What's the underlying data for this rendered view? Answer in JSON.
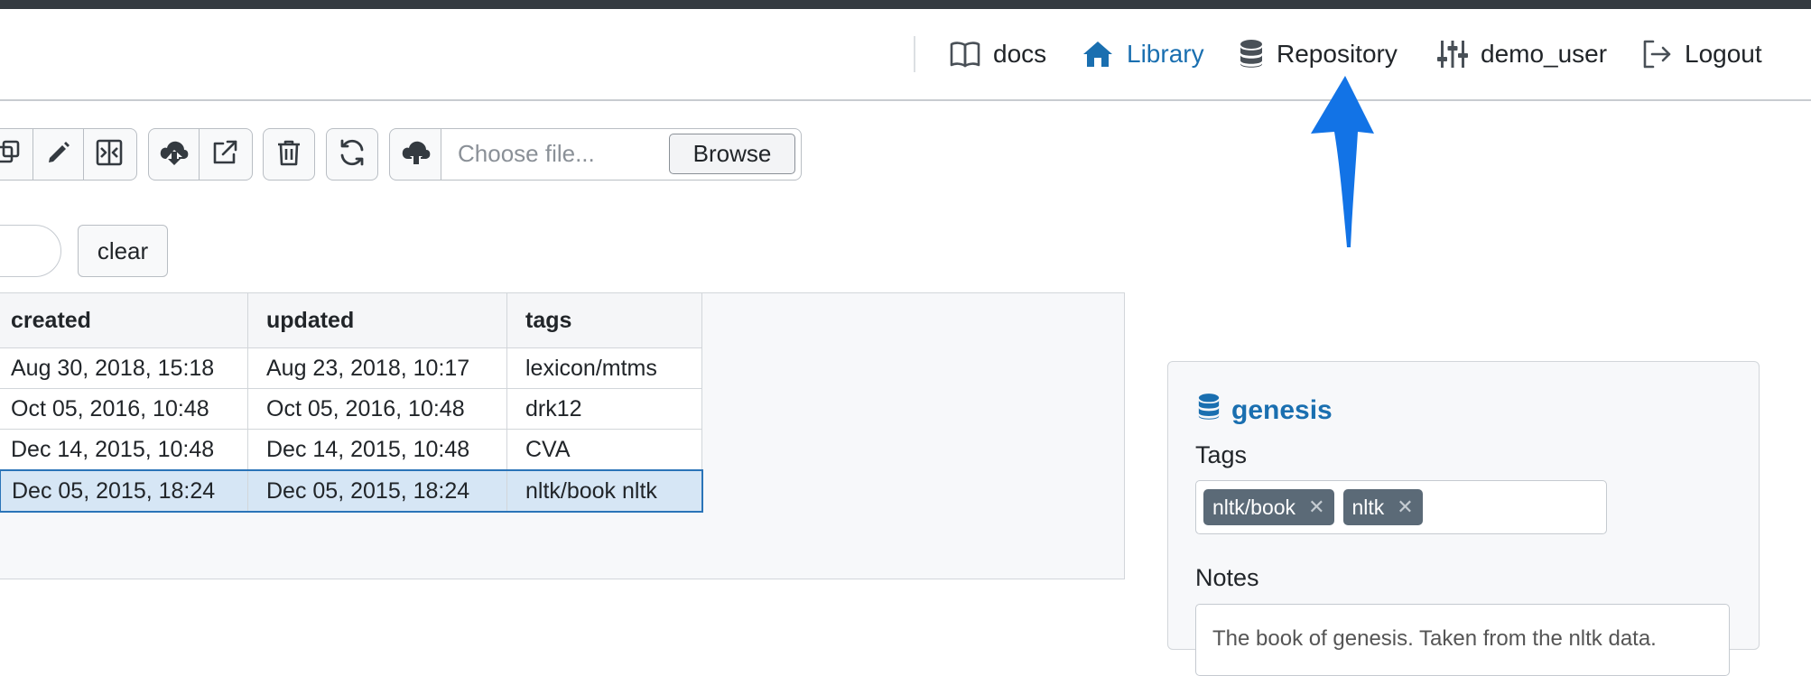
{
  "nav": {
    "docs": "docs",
    "library": "Library",
    "repository": "Repository",
    "user": "demo_user",
    "logout": "Logout"
  },
  "toolbar": {
    "file_placeholder": "Choose file...",
    "browse_label": "Browse",
    "clear_label": "clear"
  },
  "grid": {
    "columns": [
      "created",
      "updated",
      "tags"
    ],
    "rows": [
      {
        "created": "Aug 30, 2018, 15:18",
        "updated": "Aug 23, 2018, 10:17",
        "tags": "lexicon/mtms"
      },
      {
        "created": "Oct 05, 2016, 10:48",
        "updated": "Oct 05, 2016, 10:48",
        "tags": "drk12"
      },
      {
        "created": "Dec 14, 2015, 10:48",
        "updated": "Dec 14, 2015, 10:48",
        "tags": "CVA"
      },
      {
        "created": "Dec 05, 2015, 18:24",
        "updated": "Dec 05, 2015, 18:24",
        "tags": "nltk/book nltk"
      }
    ],
    "selected_row": 3
  },
  "detail": {
    "title": "genesis",
    "tags_label": "Tags",
    "tags": [
      "nltk/book",
      "nltk"
    ],
    "notes_label": "Notes",
    "notes_preview": "The book of genesis. Taken from the nltk data."
  },
  "colors": {
    "accent": "#1a6fb0",
    "topbar": "#343a40",
    "selection": "#d6e6f5",
    "annotation_arrow": "#1273e6"
  }
}
